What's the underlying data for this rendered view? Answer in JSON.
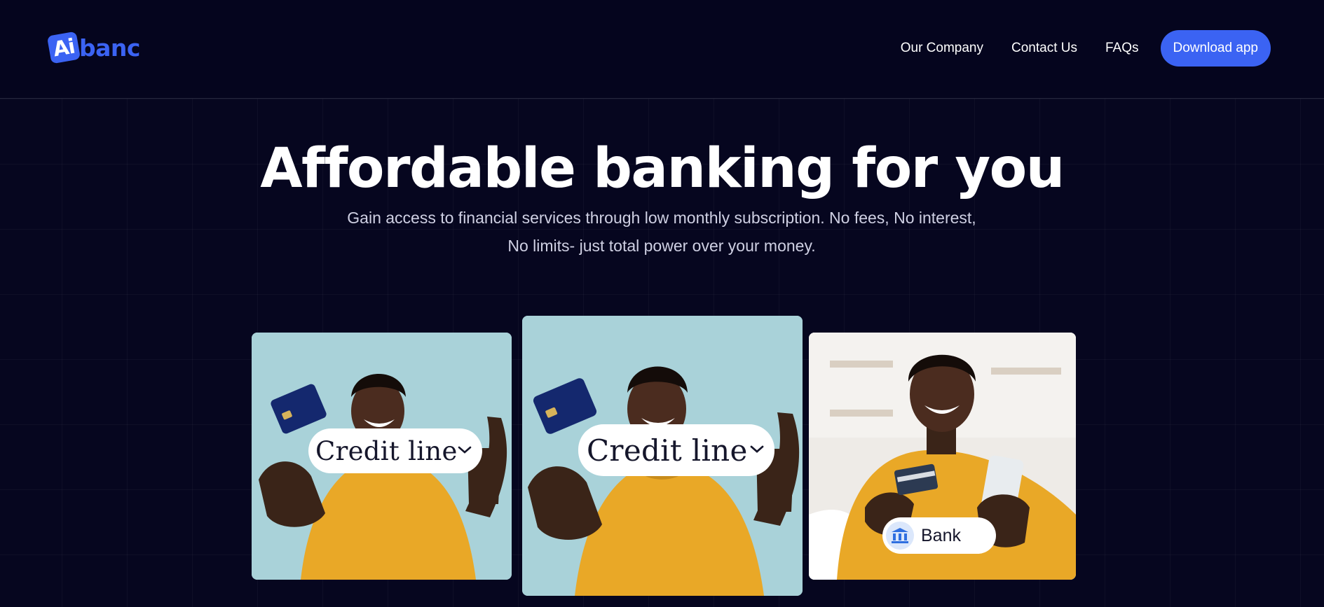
{
  "brand": {
    "badge": "Ai",
    "name": "banc",
    "accent": "#3b63f3"
  },
  "nav": {
    "links": [
      "Our Company",
      "Contact Us",
      "FAQs"
    ],
    "download_label": "Download app"
  },
  "hero": {
    "title": "Affordable banking for you",
    "subtitle": "Gain access to financial services through low monthly subscription. No fees, No interest, No limits- just total power over your money."
  },
  "cards": [
    {
      "image": "man-yellow-sweater-holding-credit-card-thumbs-up",
      "pill_label": "Credit line",
      "pill_icon": "chevron-down-icon"
    },
    {
      "image": "man-yellow-sweater-holding-credit-card-thumbs-up",
      "pill_label": "Credit line",
      "pill_icon": "chevron-down-icon"
    },
    {
      "image": "man-yellow-sweater-sofa-holding-card-and-phone",
      "pill_label": "Bank",
      "pill_icon": "bank-icon"
    }
  ],
  "colors": {
    "background": "#06061f",
    "primary": "#3b63f3",
    "sweater": "#e9a827",
    "card_sky": "#a9d2d9"
  }
}
